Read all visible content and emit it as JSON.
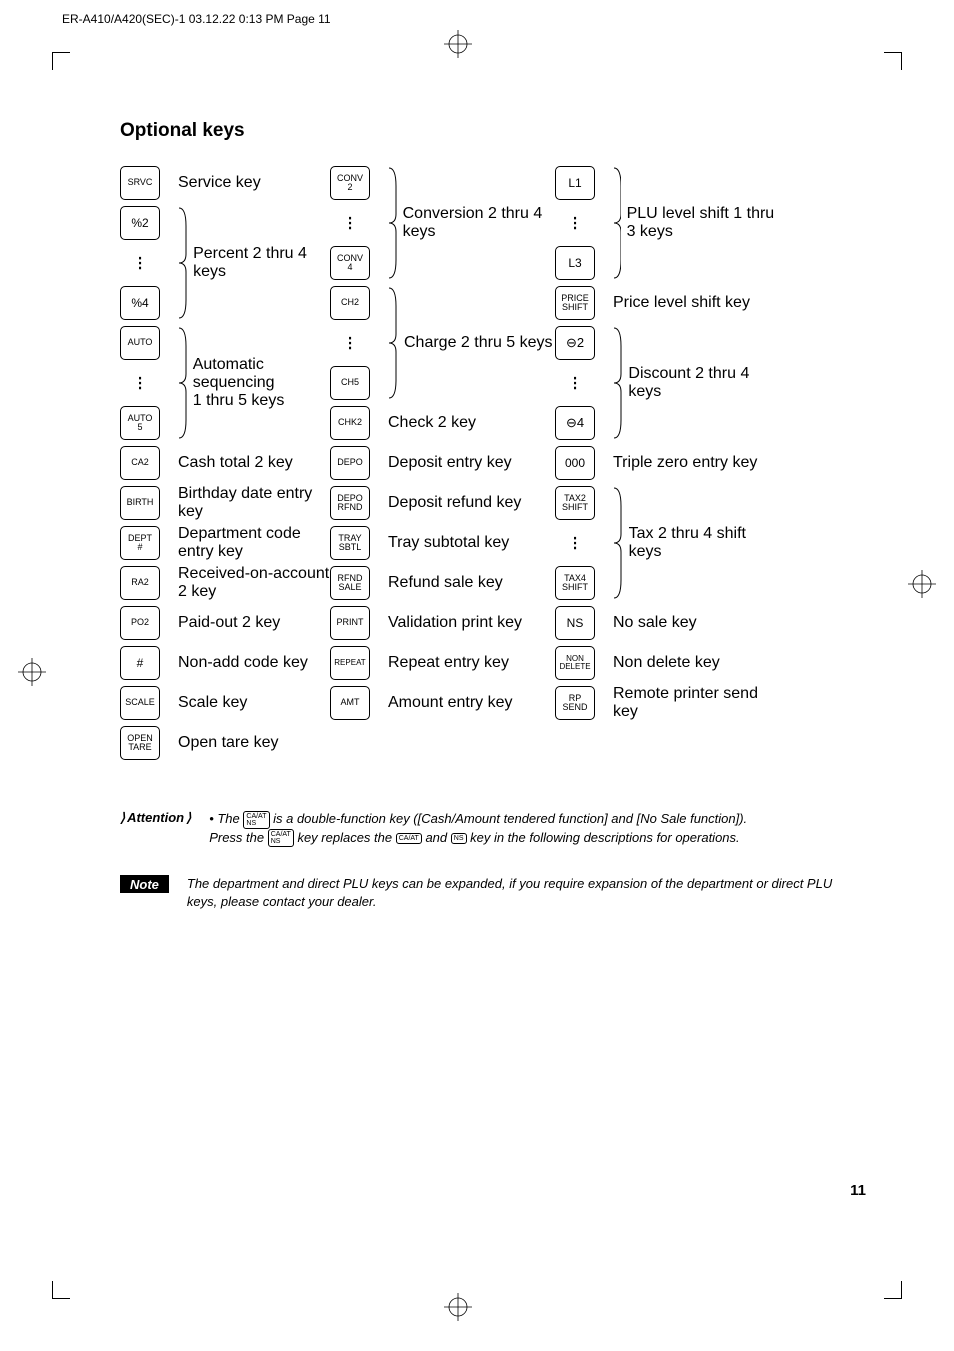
{
  "header": "ER-A410/A420(SEC)-1  03.12.22 0:13 PM  Page 11",
  "heading": "Optional keys",
  "col1": {
    "keys": [
      "SRVC",
      "%2",
      "%4",
      "AUTO",
      "AUTO\n5",
      "CA2",
      "BIRTH",
      "DEPT\n#",
      "RA2",
      "PO2",
      "#",
      "SCALE",
      "OPEN\nTARE"
    ],
    "descs": {
      "srvc": "Service key",
      "percent": "Percent 2 thru 4 keys",
      "auto": "Automatic sequencing\n1 thru 5 keys",
      "ca2": "Cash total 2 key",
      "birth": "Birthday date entry key",
      "dept": "Department code entry key",
      "ra2": "Received-on-account 2 key",
      "po2": "Paid-out 2 key",
      "num": "Non-add code key",
      "scale": "Scale key",
      "open": "Open tare key"
    }
  },
  "col2": {
    "keys": [
      "CONV\n2",
      "CONV\n4",
      "CH2",
      "CH5",
      "CHK2",
      "DEPO",
      "DEPO\nRFND",
      "TRAY\nSBTL",
      "RFND\nSALE",
      "PRINT",
      "REPEAT",
      "AMT"
    ],
    "descs": {
      "conv": "Conversion 2 thru 4 keys",
      "ch": "Charge 2 thru 5 keys",
      "chk2": "Check 2 key",
      "depo": "Deposit entry key",
      "deporfnd": "Deposit refund key",
      "tray": "Tray subtotal key",
      "rfnd": "Refund sale key",
      "print": "Validation print key",
      "repeat": "Repeat entry key",
      "amt": "Amount entry key"
    }
  },
  "col3": {
    "keys": [
      "L1",
      "L3",
      "PRICE\nSHIFT",
      "⊖2",
      "⊖4",
      "000",
      "TAX2\nSHIFT",
      "TAX4\nSHIFT",
      "NS",
      "NON\nDELETE",
      "RP\nSEND"
    ],
    "descs": {
      "plu": "PLU level shift 1 thru 3 keys",
      "price": "Price level shift key",
      "disc": "Discount 2 thru 4 keys",
      "zero": "Triple zero entry key",
      "tax": "Tax 2 thru 4 shift keys",
      "ns": "No sale key",
      "nondel": "Non delete key",
      "rp": "Remote printer send key"
    }
  },
  "attention": {
    "label": "Attention",
    "line1a": "• The ",
    "key1": "CA/AT\nNS",
    "line1b": " is a double-function key ([Cash/Amount tendered function] and [No Sale function]).",
    "line2a": "Press the ",
    "key2": "CA/AT\nNS",
    "line2b": " key replaces the ",
    "key3": "CA/AT",
    "line2c": " and ",
    "key4": "NS",
    "line2d": " key in the following descriptions for operations."
  },
  "note": {
    "label": "Note",
    "body": "The department and direct PLU keys can be expanded, if you require expansion of the department or direct PLU keys, please contact your dealer."
  },
  "pagenum": "11"
}
